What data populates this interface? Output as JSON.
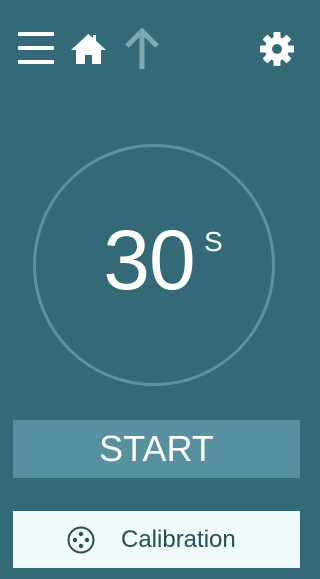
{
  "toolbar": {
    "icons": [
      "menu-icon",
      "home-icon",
      "arrow-up-icon",
      "gear-icon"
    ]
  },
  "timer": {
    "value": "30",
    "unit": "S"
  },
  "actions": {
    "start_label": "START",
    "calibration_label": "Calibration",
    "calibration_icon": "dots-circle-icon"
  },
  "colors": {
    "background": "#346a77",
    "ring": "#5d93a0",
    "start_button": "#5790a0",
    "calibration_button": "#f1fafc",
    "calibration_text": "#264f5a",
    "arrow_disabled": "#7fa9b2",
    "icon": "#ffffff"
  }
}
